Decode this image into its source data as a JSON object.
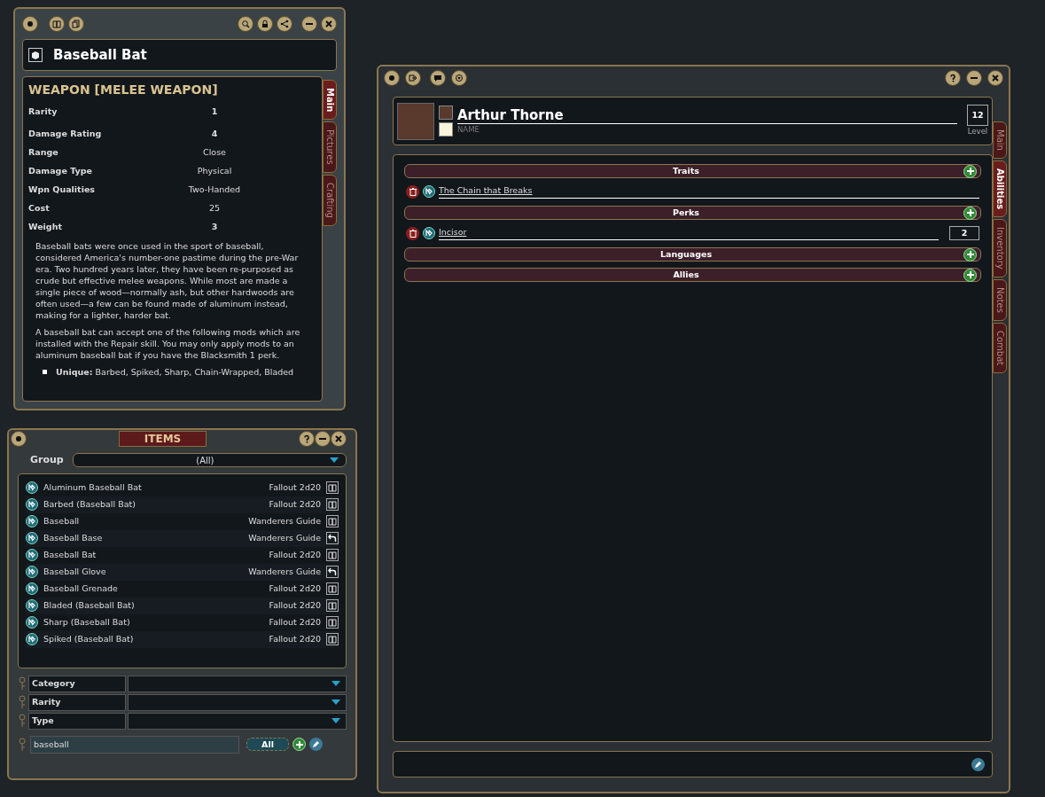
{
  "item_window": {
    "title": "Baseball Bat",
    "heading": "WEAPON [MELEE WEAPON]",
    "stats": [
      {
        "label": "Rarity",
        "value": "1",
        "bold": true
      },
      {
        "label": "Damage Rating",
        "value": "4",
        "bold": true
      },
      {
        "label": "Range",
        "value": "Close",
        "bold": false
      },
      {
        "label": "Damage Type",
        "value": "Physical",
        "bold": false
      },
      {
        "label": "Wpn Qualities",
        "value": "Two-Handed",
        "bold": false
      },
      {
        "label": "Cost",
        "value": "25",
        "bold": false
      },
      {
        "label": "Weight",
        "value": "3",
        "bold": true
      }
    ],
    "paragraphs": [
      "Baseball bats were once used in the sport of baseball, considered America's number-one pastime during the pre-War era. Two hundred years later, they have been re-purposed as crude but effective melee weapons. While most are made a single piece of wood—normally ash, but other hardwoods are often used—a few can be found made of aluminum instead, making for a lighter, harder bat.",
      "A baseball bat can accept one of the following mods which are installed with the Repair skill. You may only apply mods to an aluminum baseball bat if you have the Blacksmith 1 perk."
    ],
    "bullets": [
      "**Unique:** Barbed, Spiked, Sharp, Chain-Wrapped, Bladed"
    ],
    "tabs": [
      {
        "label": "Main",
        "selected": true
      },
      {
        "label": "Pictures",
        "selected": false
      },
      {
        "label": "Crafting",
        "selected": false
      }
    ]
  },
  "items_window": {
    "title": "ITEMS",
    "group_label": "Group",
    "group_value": "(All)",
    "rows": [
      {
        "name": "Aluminum Baseball Bat",
        "source": "Fallout 2d20",
        "kind": "book"
      },
      {
        "name": "Barbed (Baseball Bat)",
        "source": "Fallout 2d20",
        "kind": "book"
      },
      {
        "name": "Baseball",
        "source": "Wanderers Guide",
        "kind": "book"
      },
      {
        "name": "Baseball Base",
        "source": "Wanderers Guide",
        "kind": "return"
      },
      {
        "name": "Baseball Bat",
        "source": "Fallout 2d20",
        "kind": "book"
      },
      {
        "name": "Baseball Glove",
        "source": "Wanderers Guide",
        "kind": "return"
      },
      {
        "name": "Baseball Grenade",
        "source": "Fallout 2d20",
        "kind": "book"
      },
      {
        "name": "Bladed (Baseball Bat)",
        "source": "Fallout 2d20",
        "kind": "book"
      },
      {
        "name": "Sharp (Baseball Bat)",
        "source": "Fallout 2d20",
        "kind": "book"
      },
      {
        "name": "Spiked (Baseball Bat)",
        "source": "Fallout 2d20",
        "kind": "book"
      }
    ],
    "filters": [
      {
        "label": "Category"
      },
      {
        "label": "Rarity"
      },
      {
        "label": "Type"
      }
    ],
    "search": {
      "value": "baseball"
    },
    "all_button": "All"
  },
  "character_window": {
    "name": "Arthur Thorne",
    "name_caption": "NAME",
    "level": "12",
    "level_caption": "Level",
    "sections": [
      {
        "title": "Traits",
        "entries": [
          {
            "name": "The Chain that Breaks"
          }
        ]
      },
      {
        "title": "Perks",
        "entries": [
          {
            "name": "Incisor",
            "rank": "2"
          }
        ]
      },
      {
        "title": "Languages"
      },
      {
        "title": "Allies"
      }
    ],
    "tabs": [
      {
        "label": "Main",
        "selected": false
      },
      {
        "label": "Abilities",
        "selected": true
      },
      {
        "label": "Inventory",
        "selected": false
      },
      {
        "label": "Notes",
        "selected": false
      },
      {
        "label": "Combat",
        "selected": false
      }
    ]
  }
}
